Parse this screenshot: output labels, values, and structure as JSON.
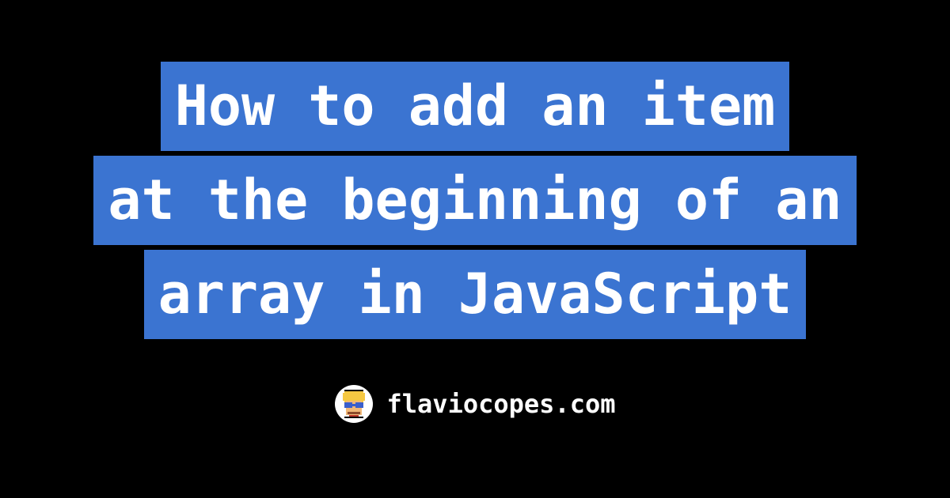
{
  "title": {
    "line1": "How to add an item",
    "line2": "at the beginning of an",
    "line3": "array in JavaScript"
  },
  "footer": {
    "site_name": "flaviocopes.com"
  },
  "colors": {
    "background": "#000000",
    "title_highlight": "#3b74d1",
    "text": "#ffffff"
  }
}
